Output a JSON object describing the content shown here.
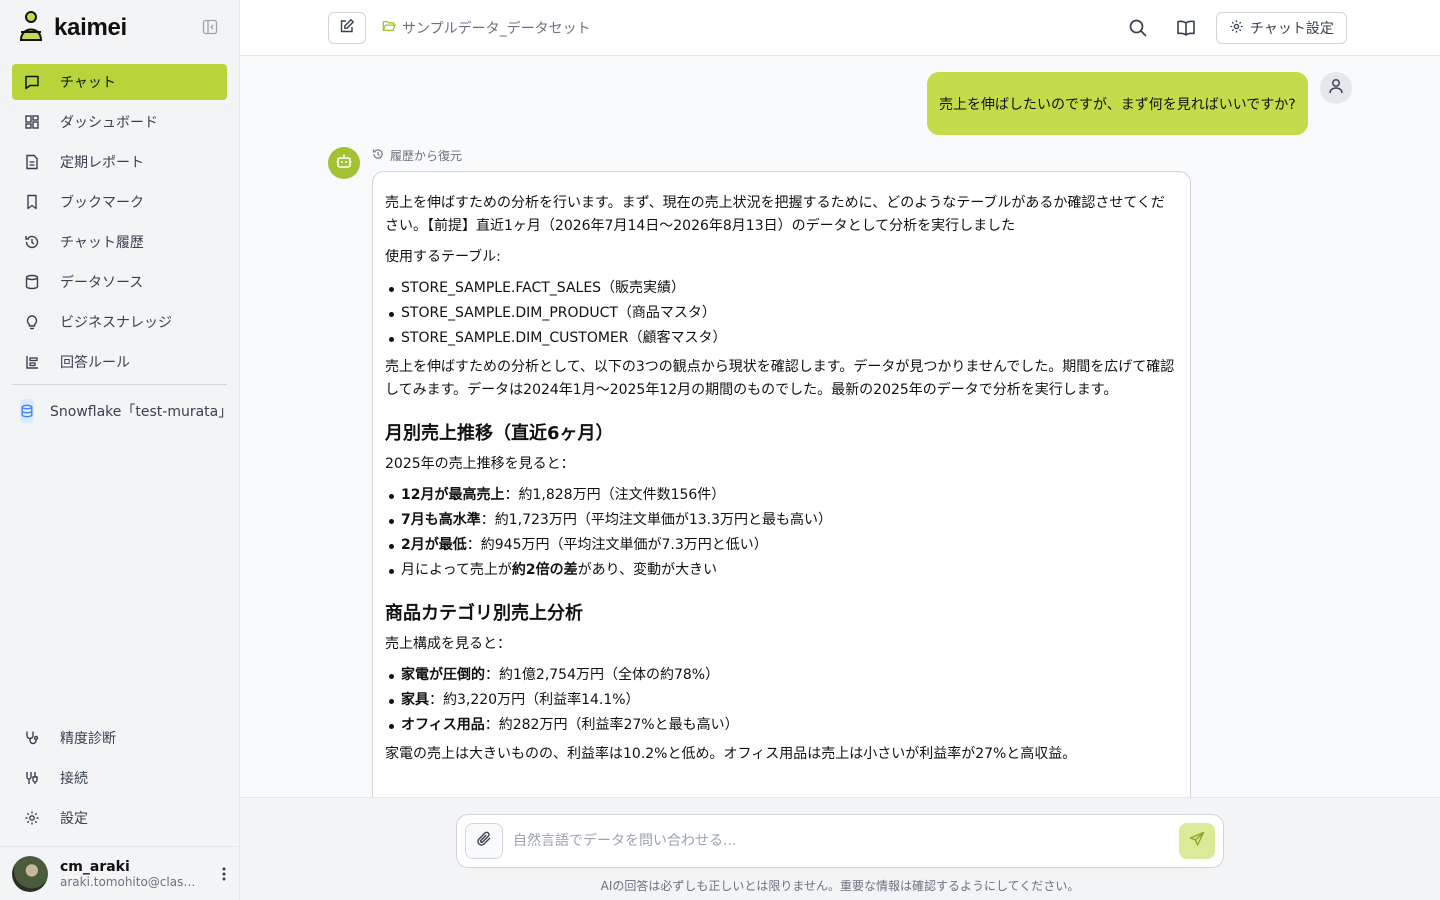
{
  "app": {
    "name": "kaimei"
  },
  "sidebar": {
    "items": [
      {
        "label": "チャット",
        "icon": "chat-icon",
        "active": true
      },
      {
        "label": "ダッシュボード",
        "icon": "dashboard-icon"
      },
      {
        "label": "定期レポート",
        "icon": "report-icon"
      },
      {
        "label": "ブックマーク",
        "icon": "bookmark-icon"
      },
      {
        "label": "チャット履歴",
        "icon": "history-icon"
      },
      {
        "label": "データソース",
        "icon": "database-icon"
      },
      {
        "label": "ビジネスナレッジ",
        "icon": "lightbulb-icon"
      },
      {
        "label": "回答ルール",
        "icon": "rules-icon"
      }
    ],
    "datasource": "Snowflake「test-murata」",
    "bottom_items": [
      {
        "label": "精度診断",
        "icon": "stethoscope-icon"
      },
      {
        "label": "接続",
        "icon": "connection-icon"
      },
      {
        "label": "設定",
        "icon": "gear-icon"
      }
    ],
    "user": {
      "name": "cm_araki",
      "email": "araki.tomohito@class..."
    }
  },
  "topbar": {
    "breadcrumb": "サンプルデータ_データセット",
    "settings_label": "チャット設定"
  },
  "chat": {
    "user_message": "売上を伸ばしたいのですが、まず何を見ればいいですか?",
    "restored_label": "履歴から復元",
    "intro": "売上を伸ばすための分析を行います。まず、現在の売上状況を把握するために、どのようなテーブルがあるか確認させてください。【前提】直近1ヶ月（2026年7月14日〜2026年8月13日）のデータとして分析を実行しました",
    "tables_label": "使用するテーブル:",
    "tables": [
      "STORE_SAMPLE.FACT_SALES（販売実績）",
      "STORE_SAMPLE.DIM_PRODUCT（商品マスタ）",
      "STORE_SAMPLE.DIM_CUSTOMER（顧客マスタ）"
    ],
    "context": "売上を伸ばすための分析として、以下の3つの観点から現状を確認します。データが見つかりませんでした。期間を広げて確認してみます。データは2024年1月〜2025年12月の期間のものでした。最新の2025年のデータで分析を実行します。",
    "section1": {
      "title": "月別売上推移（直近6ヶ月）",
      "lead": "2025年の売上推移を見ると：",
      "items": [
        {
          "bold": "12月が最高売上",
          "rest": "：約1,828万円（注文件数156件）"
        },
        {
          "bold": "7月も高水準",
          "rest": "：約1,723万円（平均注文単価が13.3万円と最も高い）"
        },
        {
          "bold": "2月が最低",
          "rest": "：約945万円（平均注文単価が7.3万円と低い）"
        },
        {
          "pre": "月によって売上が",
          "bold": "約2倍の差",
          "rest": "があり、変動が大きい"
        }
      ]
    },
    "section2": {
      "title": "商品カテゴリ別売上分析",
      "lead": "売上構成を見ると：",
      "items": [
        {
          "bold": "家電が圧倒的",
          "rest": "：約1億2,754万円（全体の約78%）"
        },
        {
          "bold": "家具",
          "rest": "：約3,220万円（利益率14.1%）"
        },
        {
          "bold": "オフィス用品",
          "rest": "：約282万円（利益率27%と最も高い）"
        }
      ],
      "summary": "家電の売上は大きいものの、利益率は10.2%と低め。オフィス用品は売上は小さいが利益率が27%と高収益。"
    }
  },
  "composer": {
    "placeholder": "自然言語でデータを問い合わせる...",
    "disclaimer": "AIの回答は必ずしも正しいとは限りません。重要な情報は確認するようにしてください。"
  },
  "colors": {
    "accent": "#b9d43a",
    "user_bubble": "#c4dc4a",
    "bot_avatar": "#a3c233"
  }
}
